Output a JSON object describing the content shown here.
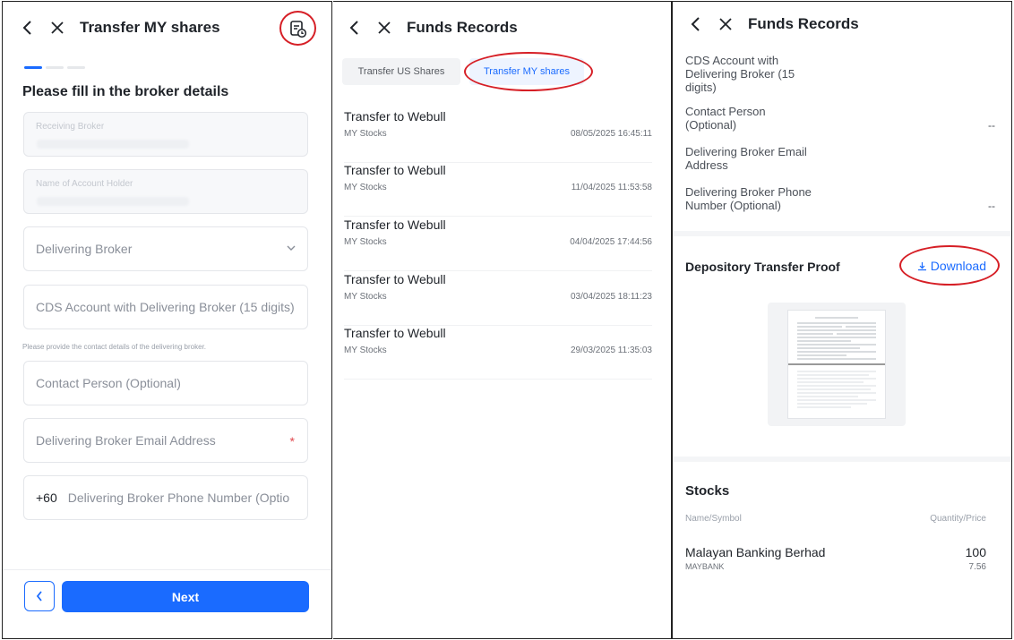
{
  "colors": {
    "accent": "#1a6bff",
    "annotation": "#d61f26",
    "required": "#e0484e"
  },
  "panel1": {
    "header": {
      "title": "Transfer MY shares",
      "back_icon": "chevron-left-icon",
      "close_icon": "close-icon",
      "history_icon": "records-clock-icon"
    },
    "progress": {
      "steps": 3,
      "current": 1
    },
    "heading": "Please fill in the broker details",
    "fields": {
      "receiving_broker": "Receiving Broker",
      "account_holder": "Name of Account Holder",
      "delivering_broker": "Delivering Broker",
      "cds_account": "CDS Account with Delivering Broker (15 digits)",
      "contact_person": "Contact Person (Optional)",
      "email": "Delivering Broker Email Address",
      "email_required": "*",
      "phone_prefix": "+60",
      "phone": "Delivering Broker Phone Number (Optio"
    },
    "hint": "Please provide the contact details of the delivering broker.",
    "next_label": "Next"
  },
  "panel2": {
    "header": {
      "title": "Funds Records"
    },
    "tabs": [
      {
        "label": "Transfer US Shares",
        "active": false
      },
      {
        "label": "Transfer MY shares",
        "active": true
      }
    ],
    "records": [
      {
        "title": "Transfer to Webull",
        "sub": "MY Stocks",
        "time": "08/05/2025 16:45:11"
      },
      {
        "title": "Transfer to Webull",
        "sub": "MY Stocks",
        "time": "11/04/2025 11:53:58"
      },
      {
        "title": "Transfer to Webull",
        "sub": "MY Stocks",
        "time": "04/04/2025 17:44:56"
      },
      {
        "title": "Transfer to Webull",
        "sub": "MY Stocks",
        "time": "03/04/2025 18:11:23"
      },
      {
        "title": "Transfer to Webull",
        "sub": "MY Stocks",
        "time": "29/03/2025 11:35:03"
      }
    ]
  },
  "panel3": {
    "header": {
      "title": "Funds Records"
    },
    "details": [
      {
        "label": "CDS Account with Delivering Broker (15 digits)",
        "value": ""
      },
      {
        "label": "Contact Person (Optional)",
        "value": "--"
      },
      {
        "label": "Delivering Broker Email Address",
        "value": ""
      },
      {
        "label": "Delivering Broker Phone Number (Optional)",
        "value": "--"
      }
    ],
    "proof_title": "Depository Transfer Proof",
    "download_label": "Download",
    "stocks": {
      "title": "Stocks",
      "col_left": "Name/Symbol",
      "col_right": "Quantity/Price",
      "rows": [
        {
          "name": "Malayan Banking Berhad",
          "symbol": "MAYBANK",
          "quantity": "100",
          "price": "7.56"
        }
      ]
    }
  }
}
